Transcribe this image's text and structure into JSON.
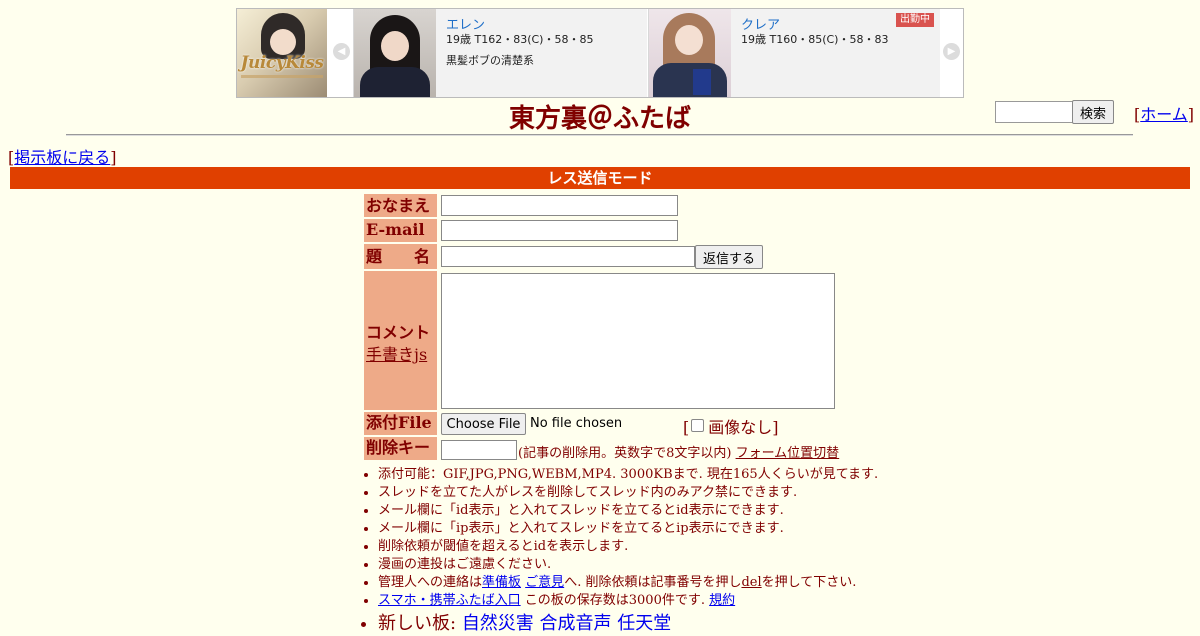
{
  "banner": {
    "logo_text": "JuicyKiss",
    "prev_arrow": "◀",
    "next_arrow": "▶",
    "cards": [
      {
        "name": "エレン",
        "stats": "19歳 T162・83(C)・58・85",
        "desc": "黒髪ボブの清楚系",
        "badge": ""
      },
      {
        "name": "クレア",
        "stats": "19歳 T160・85(C)・58・83",
        "desc": "",
        "badge": "出勤中"
      }
    ]
  },
  "header": {
    "title": "東方裏＠ふたば",
    "search_button": "検索",
    "search_placeholder": "",
    "home_link": "ホーム"
  },
  "nav": {
    "back_link": "掲示板に戻る"
  },
  "mode_bar": "レス送信モード",
  "form": {
    "name_label": "おなまえ",
    "email_label": "E-mail",
    "subject_label": "題　　名",
    "submit_button": "返信する",
    "comment_label": "コメント",
    "handwriting_link": "手書きjs",
    "file_label": "添付File",
    "file_button": "Choose File",
    "file_status": "No file chosen",
    "no_image_label": "画像なし",
    "delkey_label": "削除キー",
    "delkey_note": "(記事の削除用。英数字で8文字以内)",
    "form_position_link": "フォーム位置切替"
  },
  "notes": {
    "n1": "添付可能：GIF,JPG,PNG,WEBM,MP4. 3000KBまで. 現在165人くらいが見てます.",
    "n2": "スレッドを立てた人がレスを削除してスレッド内のみアク禁にできます.",
    "n3": "メール欄に「id表示」と入れてスレッドを立てるとid表示にできます.",
    "n4": "メール欄に「ip表示」と入れてスレッドを立てるとip表示にできます.",
    "n5": "削除依頼が閾値を超えるとidを表示します.",
    "n6": "漫画の連投はご遠慮ください.",
    "n7_pre": "管理人への連絡は",
    "n7_link1": "準備板",
    "n7_link2": "ご意見",
    "n7_mid": "へ. 削除依頼は記事番号を押し",
    "n7_del": "del",
    "n7_post": "を押して下さい.",
    "n8_link": "スマホ・携帯ふたば入口",
    "n8_mid": "この板の保存数は3000件です.",
    "n8_rules": "規約",
    "n9_pre": "新しい板:",
    "n9_b1": "自然災害",
    "n9_b2": "合成音声",
    "n9_b3": "任天堂"
  }
}
